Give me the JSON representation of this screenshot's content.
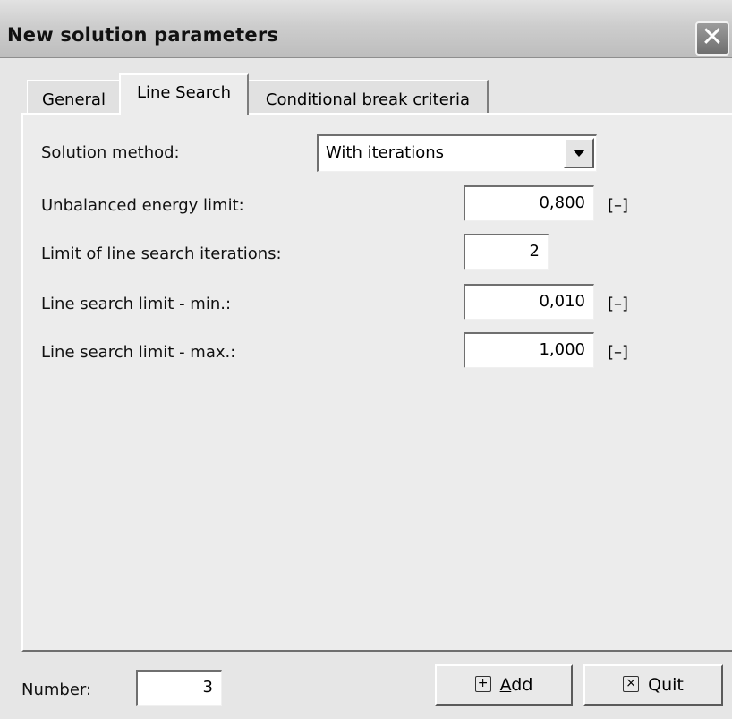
{
  "window": {
    "title": "New solution parameters",
    "close_glyph": "✕"
  },
  "tabs": [
    {
      "label": "General",
      "active": false
    },
    {
      "label": "Line Search",
      "active": true
    },
    {
      "label": "Conditional break criteria",
      "active": false
    }
  ],
  "form": {
    "solution_method": {
      "label": "Solution method:",
      "value": "With iterations"
    },
    "unbalanced_energy_limit": {
      "label": "Unbalanced energy limit:",
      "value": "0,800",
      "unit": "[–]"
    },
    "limit_line_search_iterations": {
      "label": "Limit of line search iterations:",
      "value": "2"
    },
    "line_search_limit_min": {
      "label": "Line search limit - min.:",
      "value": "0,010",
      "unit": "[–]"
    },
    "line_search_limit_max": {
      "label": "Line search limit - max.:",
      "value": "1,000",
      "unit": "[–]"
    }
  },
  "footer": {
    "number_label": "Number:",
    "number_value": "3",
    "add_label_mnemonic": "A",
    "add_label_rest": "dd",
    "quit_label": "Quit",
    "add_icon": "plus-box-icon",
    "quit_icon": "x-box-icon"
  },
  "colors": {
    "window_bg": "#e6e6e6",
    "titlebar": "#c8c8c8",
    "field_bg": "#ffffff"
  }
}
